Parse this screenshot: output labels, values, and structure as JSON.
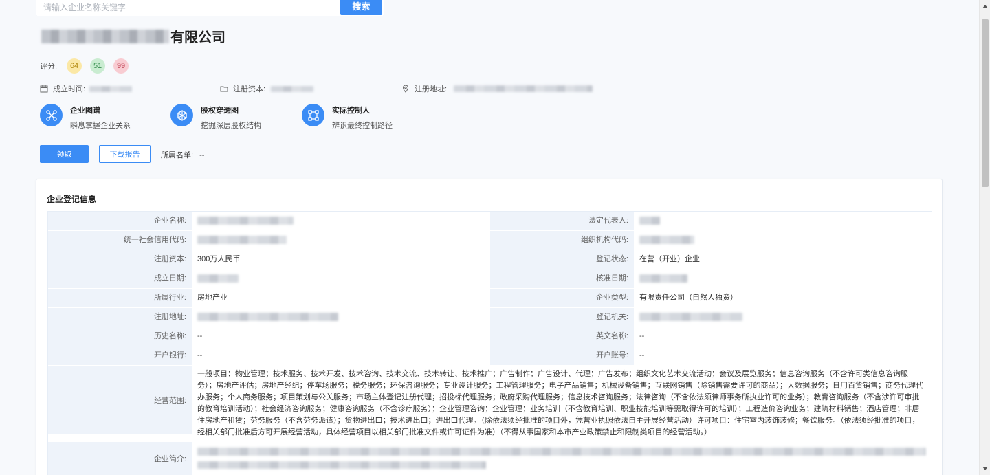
{
  "search": {
    "placeholder": "请输入企业名称关键字",
    "button": "搜索"
  },
  "company": {
    "name_suffix": "有限公司"
  },
  "scores": {
    "label": "评分:",
    "values": [
      {
        "value": "64",
        "bg": "#fbe8a6",
        "fg": "#b38a10"
      },
      {
        "value": "51",
        "bg": "#c9ecd1",
        "fg": "#3a8f52"
      },
      {
        "value": "99",
        "bg": "#f8ccd2",
        "fg": "#c14557"
      }
    ]
  },
  "meta": {
    "established_label": "成立时间:",
    "capital_label": "注册资本:",
    "address_label": "注册地址:"
  },
  "features": [
    {
      "title": "企业图谱",
      "desc": "瞬息掌握企业关系",
      "icon": "network-icon"
    },
    {
      "title": "股权穿透图",
      "desc": "挖掘深层股权结构",
      "icon": "structure-icon"
    },
    {
      "title": "实际控制人",
      "desc": "辨识最终控制路径",
      "icon": "control-icon"
    }
  ],
  "actions": {
    "claim": "领取",
    "download": "下载报告",
    "list_label": "所属名单:",
    "list_value": "--"
  },
  "registration": {
    "title": "企业登记信息",
    "rows": [
      {
        "l1": "企业名称:",
        "v1": "",
        "l2": "法定代表人:",
        "v2": ""
      },
      {
        "l1": "统一社会信用代码:",
        "v1": "",
        "l2": "组织机构代码:",
        "v2": ""
      },
      {
        "l1": "注册资本:",
        "v1": "300万人民币",
        "l2": "登记状态:",
        "v2": "在营（开业）企业"
      },
      {
        "l1": "成立日期:",
        "v1": "",
        "l2": "核准日期:",
        "v2": ""
      },
      {
        "l1": "所属行业:",
        "v1": "房地产业",
        "l2": "企业类型:",
        "v2": "有限责任公司（自然人独资）"
      },
      {
        "l1": "注册地址:",
        "v1": "",
        "l2": "登记机关:",
        "v2": ""
      },
      {
        "l1": "历史名称:",
        "v1": "--",
        "l2": "英文名称:",
        "v2": "--"
      },
      {
        "l1": "开户银行:",
        "v1": "--",
        "l2": "开户账号:",
        "v2": "--"
      }
    ],
    "scope_label": "经营范围:",
    "scope_text": "一般项目：物业管理；技术服务、技术开发、技术咨询、技术交流、技术转让、技术推广；广告制作；广告设计、代理；广告发布；组织文化艺术交流活动；会议及展览服务；信息咨询服务（不含许可类信息咨询服务）；房地产评估；房地产经纪；停车场服务；税务服务；环保咨询服务；专业设计服务；工程管理服务；电子产品销售；机械设备销售；互联网销售（除销售需要许可的商品）；大数据服务；日用百货销售；商务代理代办服务；个人商务服务；项目策划与公关服务；市场主体登记注册代理；招投标代理服务；政府采购代理服务；信息技术咨询服务；法律咨询（不含依法须律师事务所执业许可的业务）；教育咨询服务（不含涉许可审批的教育培训活动）；社会经济咨询服务；健康咨询服务（不含诊疗服务）；企业管理咨询；企业管理；业务培训（不含教育培训、职业技能培训等需取得许可的培训）；工程造价咨询业务；建筑材料销售；酒店管理；非居住房地产租赁；劳务服务（不含劳务派遣）；货物进出口；技术进出口；进出口代理。（除依法须经批准的项目外，凭营业执照依法自主开展经营活动）许可项目：住宅室内装饰装修；餐饮服务。（依法须经批准的项目，经相关部门批准后方可开展经营活动，具体经营项目以相关部门批准文件或许可证件为准）（不得从事国家和本市产业政策禁止和限制类项目的经营活动。）",
    "intro_label": "企业简介:"
  }
}
